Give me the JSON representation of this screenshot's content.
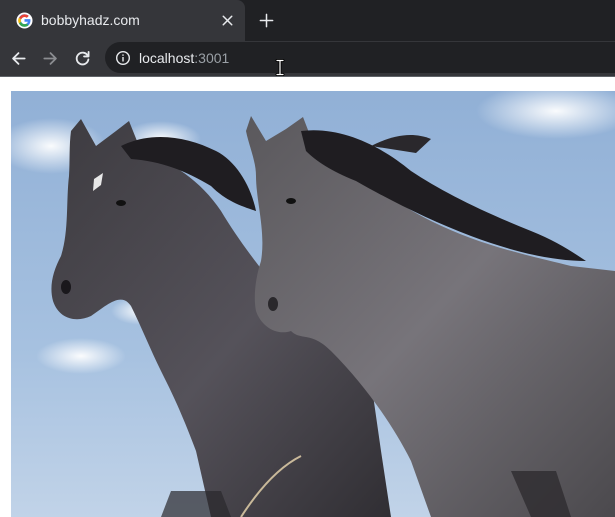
{
  "tab": {
    "title": "bobbyhadz.com",
    "favicon": "google-g-icon",
    "close_icon": "close-icon"
  },
  "new_tab_icon": "plus-icon",
  "toolbar": {
    "back_icon": "arrow-left-icon",
    "forward_icon": "arrow-right-icon",
    "reload_icon": "reload-icon",
    "site_info_icon": "info-icon"
  },
  "address_bar": {
    "host": "localhost",
    "port": ":3001"
  },
  "page": {
    "image_alt": "",
    "image_subject": "two dark horses standing side by side under a blue sky"
  },
  "colors": {
    "tab_strip": "#202124",
    "tab_active": "#35363a",
    "omnibox": "#202124",
    "text_primary": "#e8eaed",
    "text_secondary": "#9aa0a6",
    "sky": "#9db8d9"
  }
}
